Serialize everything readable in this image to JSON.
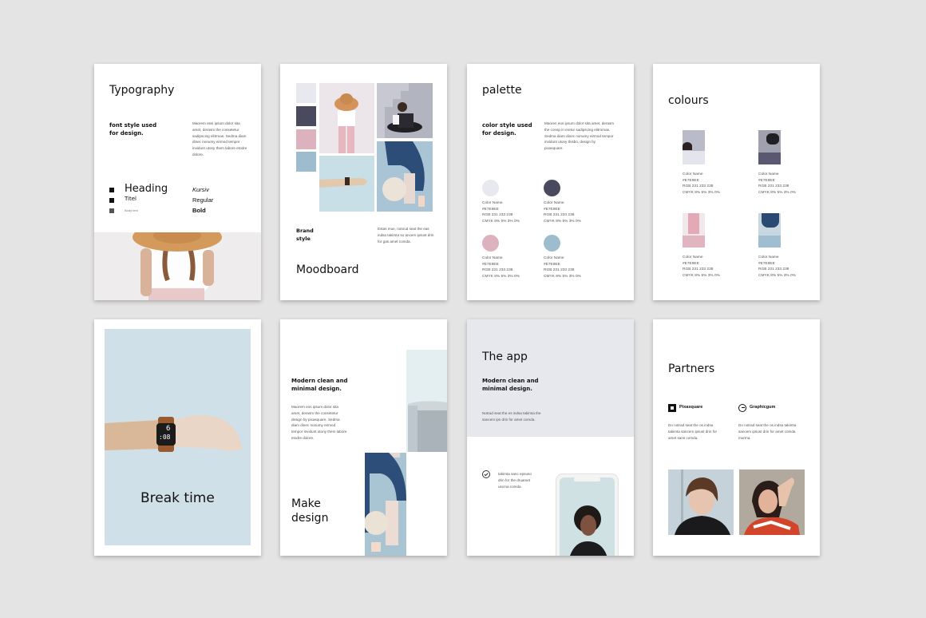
{
  "colors": {
    "background": "#e4e4e4",
    "light_grey": "#e7e9ee",
    "dark_navy": "#4a4a5e",
    "pink": "#ddb2bf",
    "blue": "#9dbdcf",
    "app_header": "#e7e8ee"
  },
  "pages": {
    "typography": {
      "title": "Typography",
      "subtitle_line1": "font style used",
      "subtitle_line2": "for design.",
      "body": "Maorem essi ipsum dolor sita amet, derasm the consetetur sadipscing elitrmas. Sedma diam dinec nonumy eirmod tempor invidunt utony them labore etodre dolore.",
      "styles": [
        {
          "label": "Heading",
          "icon": "square-bullet-icon"
        },
        {
          "label": "Titel",
          "icon": "square-bullet-icon"
        },
        {
          "label": "Body text",
          "icon": "square-bullet-icon"
        }
      ],
      "weights": [
        "Kursiv",
        "Regular",
        "Bold"
      ]
    },
    "moodboard": {
      "title": "Moodboard",
      "brand_line1": "Brand",
      "brand_line2": "style",
      "body": "Estas mue, notoud seat the eas indsa takimta so ancem ipsust drin for gas amet comda."
    },
    "palette": {
      "title": "palette",
      "subtitle_line1": "color style used",
      "subtitle_line2": "for design.",
      "body": "Maoren eos ipsum dolor sita amet, derasm the consp in eretur sadipscing elitromas. Sedma diam dinec nonumy eirmod tempor invidunt utony thisbo, design by pixasquare.",
      "swatches": [
        {
          "color": "#e7e9ee",
          "name": "Color Name",
          "hex": "#E7E9EE",
          "rgb": "RGB 231  233  238",
          "cmyk": "CMYK 8%  5%  3%  0%"
        },
        {
          "color": "#4a4a5e",
          "name": "Color Name",
          "hex": "#E7E9EE",
          "rgb": "RGB 231  233  238",
          "cmyk": "CMYK 8%  5%  3%  0%"
        },
        {
          "color": "#ddb2bf",
          "name": "Color Name",
          "hex": "#E7E9EE",
          "rgb": "RGB 231  233  238",
          "cmyk": "CMYK 8%  5%  3%  0%"
        },
        {
          "color": "#9dbdcf",
          "name": "Color Name",
          "hex": "#E7E9EE",
          "rgb": "RGB 231  233  238",
          "cmyk": "CMYK 8%  5%  3%  0%"
        }
      ]
    },
    "colours": {
      "title": "colours",
      "items": [
        {
          "color": "#e4e5ec",
          "name": "Color Name",
          "hex": "#E7E9EE",
          "rgb": "RGB 231  233  238",
          "cmyk": "CMYK 8%  5%  3%  0%"
        },
        {
          "color": "#5a5870",
          "name": "Color Name",
          "hex": "#E7E9EE",
          "rgb": "RGB 231  233  238",
          "cmyk": "CMYK 8%  5%  3%  0%"
        },
        {
          "color": "#e1b4c0",
          "name": "Color Name",
          "hex": "#E7E9EE",
          "rgb": "RGB 231  233  238",
          "cmyk": "CMYK 8%  5%  3%  0%"
        },
        {
          "color": "#9fbed0",
          "name": "Color Name",
          "hex": "#E7E9EE",
          "rgb": "RGB 231  233  238",
          "cmyk": "CMYK 8%  5%  3%  0%"
        }
      ]
    },
    "break_time": {
      "title": "Break time",
      "watch_hour": "6",
      "watch_minutes": ":08"
    },
    "make_design": {
      "subtitle_line1": "Modern clean and",
      "subtitle_line2": "minimal design.",
      "body": "Maorem eos ipsum dolor sita amet, derasm the consetetur design by pixasquare. Sedma diam dinec nonumy eirmod tempor invidunt utony them labore etodre dolore.",
      "title_line1": "Make",
      "title_line2": "design"
    },
    "the_app": {
      "title": "The app",
      "subtitle_line1": "Modern clean and",
      "subtitle_line2": "minimal design.",
      "body": "Notrad seat the es indsa takimta the sancem ips drin for amet comda.",
      "feature": "takimta sanc epsuso drin for the druamet uscma comda."
    },
    "partners": {
      "title": "Partners",
      "list": [
        {
          "name": "Pixasquare",
          "icon": "pixasquare-logo-icon",
          "body": "Do notrad seat the os indsa takimta sancem ipsust drin for amet sans comda."
        },
        {
          "name": "Graphicgum",
          "icon": "graphicgum-logo-icon",
          "body": "Do notrad seat the os indsa takimta sancem ipsust drin for amet comda murma."
        }
      ]
    }
  }
}
